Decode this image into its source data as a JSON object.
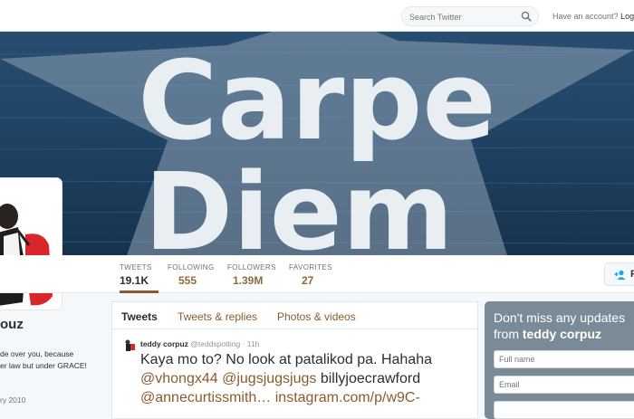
{
  "topbar": {
    "search_placeholder": "Search Twitter",
    "account_text": "Have an account?",
    "login_label": "Log in"
  },
  "banner": {
    "text_line1": "Carpe",
    "text_line2": "Diem"
  },
  "stats": [
    {
      "label": "TWEETS",
      "value": "19.1K",
      "active": true
    },
    {
      "label": "FOLLOWING",
      "value": "555"
    },
    {
      "label": "FOLLOWERS",
      "value": "1.39M"
    },
    {
      "label": "FAVORITES",
      "value": "27"
    }
  ],
  "follow_label": "F",
  "profile": {
    "name_fragment": "ouz",
    "bio_line1": "de over you, because",
    "bio_line2": "er law but under GRACE!",
    "joined_fragment": "ry 2010"
  },
  "tabs": [
    "Tweets",
    "Tweets & replies",
    "Photos & videos"
  ],
  "tweet": {
    "name": "teddy corpuz",
    "handle": "@teddspotting",
    "time": "· 11h",
    "line1": "Kaya mo to? No look at patalikod pa. Hahaha",
    "mention1": "@vhongx44",
    "mention2": "@jugsjugsjugs",
    "plain1": "billyjoecrawford",
    "mention3": "@annecurtissmith…",
    "link": "instagram.com/p/w9C-"
  },
  "signup": {
    "heading1": "Don't miss any updates",
    "heading2_prefix": "from",
    "heading2_name": "teddy corpuz",
    "fullname_placeholder": "Full name",
    "email_placeholder": "Email"
  },
  "colors": {
    "accent": "#8c5a2e",
    "signup_bg": "#7a8b97",
    "banner_sea": "#1e3a56"
  }
}
